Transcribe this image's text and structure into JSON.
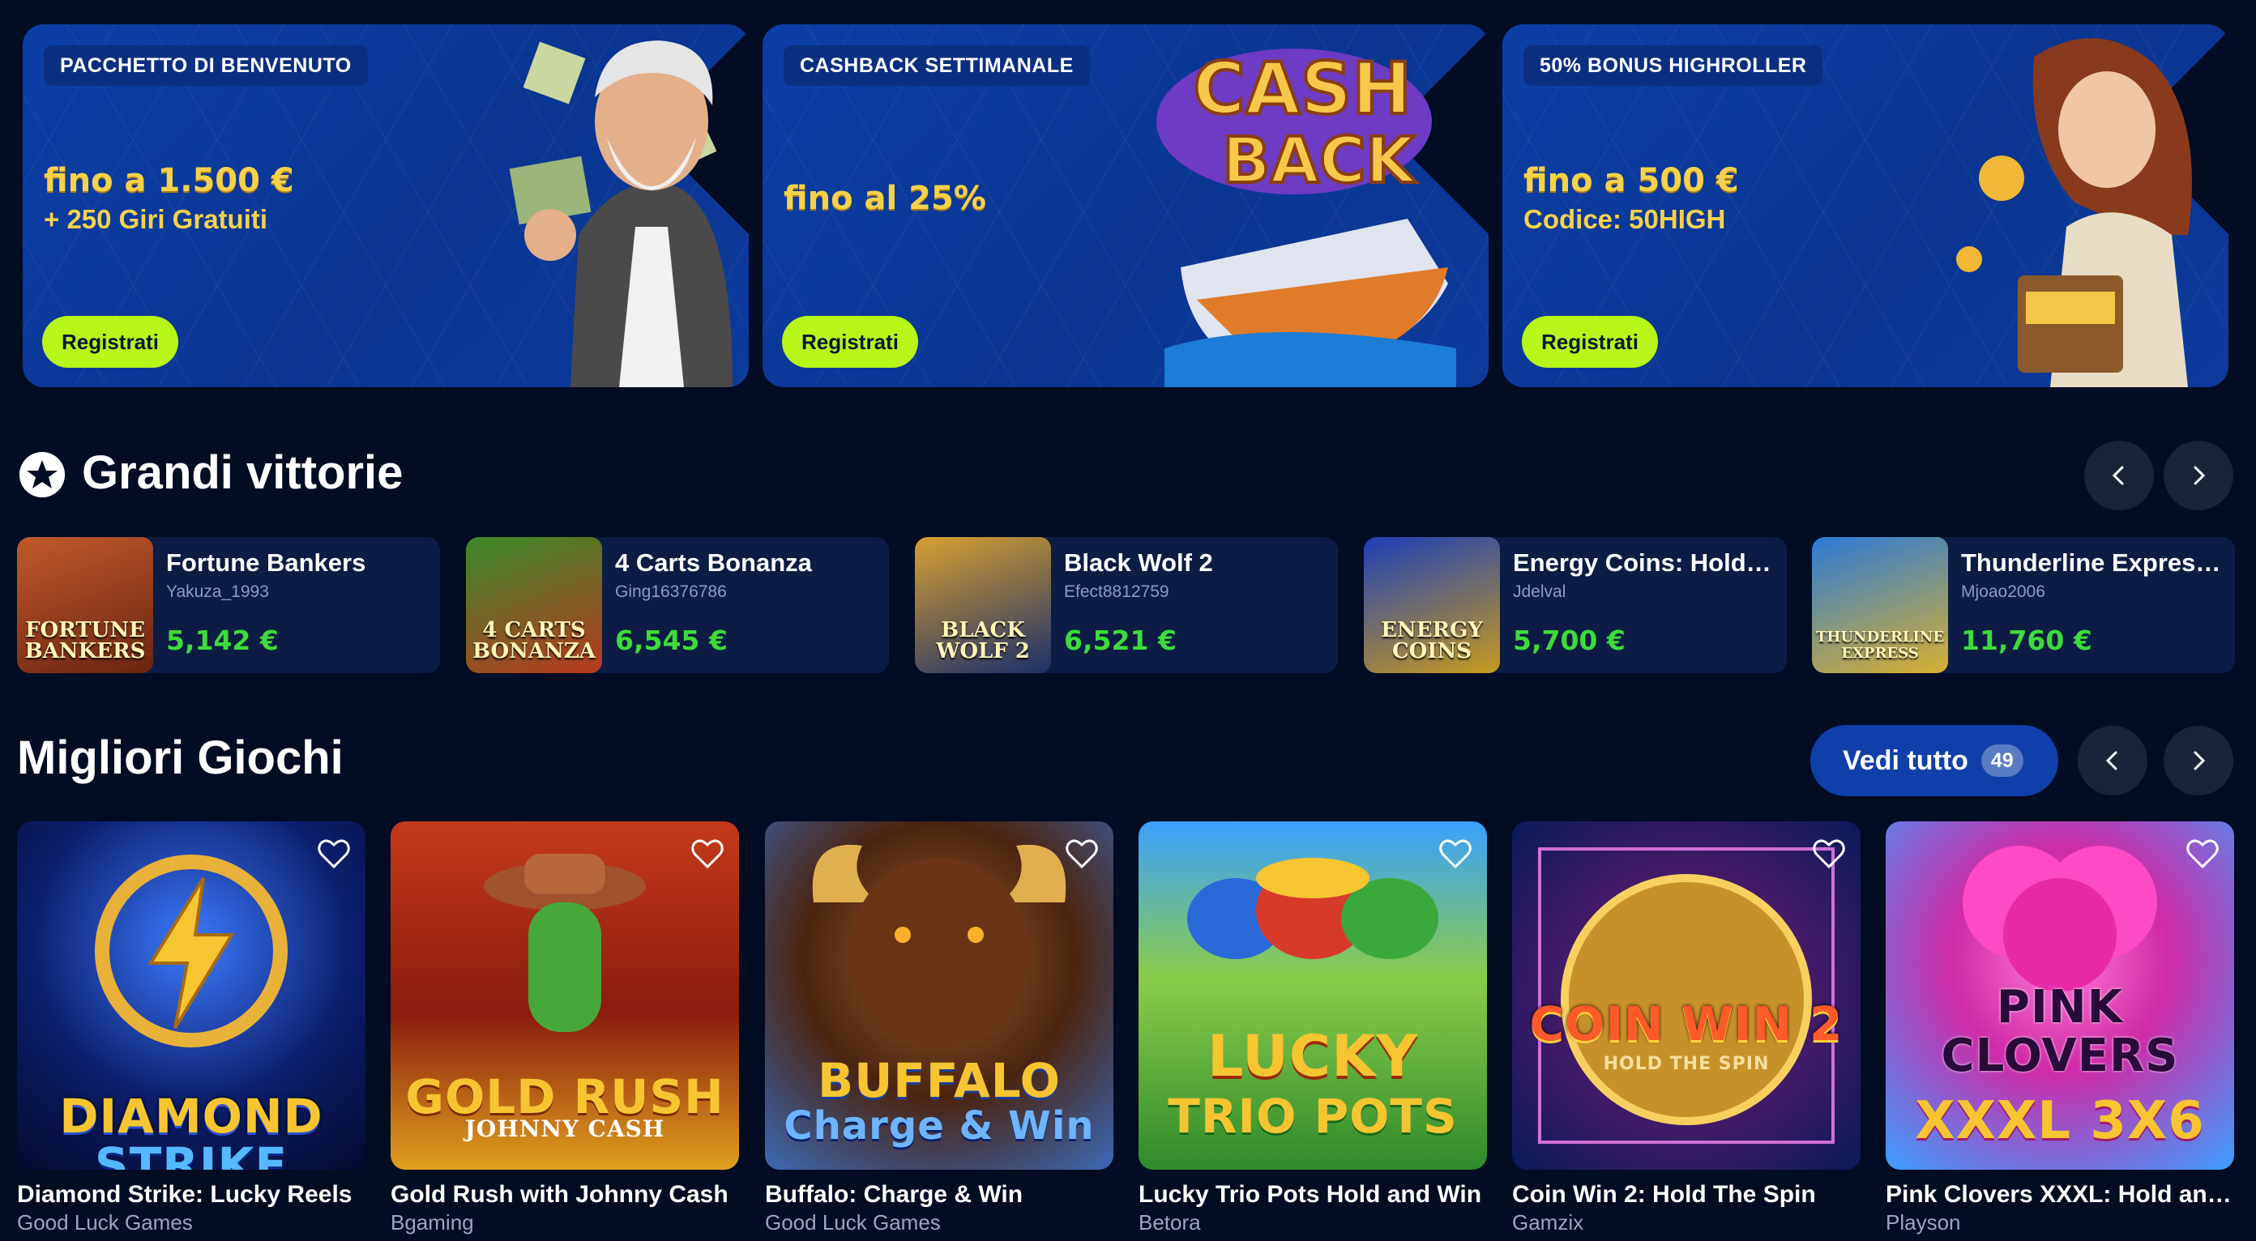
{
  "promos": [
    {
      "badge": "PACCHETTO DI BENVENUTO",
      "amount": "fino a 1.500 €",
      "subtitle": "+ 250 Giri Gratuiti",
      "button": "Registrati"
    },
    {
      "badge": "CASHBACK SETTIMANALE",
      "amount": "fino al 25%",
      "subtitle": "",
      "button": "Registrati",
      "art_text_1": "CASH",
      "art_text_2": "BACK"
    },
    {
      "badge": "50% BONUS HIGHROLLER",
      "amount": "fino a 500 €",
      "subtitle": "Codice: 50HIGH",
      "button": "Registrati"
    }
  ],
  "big_wins": {
    "title": "Grandi vittorie",
    "icon": "star-icon",
    "items": [
      {
        "game": "Fortune Bankers",
        "user": "Yakuza_1993",
        "amount": "5,142 €",
        "thumb_label": "FORTUNE BANKERS"
      },
      {
        "game": "4 Carts Bonanza",
        "user": "Ging16376786",
        "amount": "6,545 €",
        "thumb_label": "4 CARTS BONANZA"
      },
      {
        "game": "Black Wolf 2",
        "user": "Efect8812759",
        "amount": "6,521 €",
        "thumb_label": "BLACK WOLF 2"
      },
      {
        "game": "Energy Coins: Hold a...",
        "user": "Jdelval",
        "amount": "5,700 €",
        "thumb_label": "ENERGY COINS"
      },
      {
        "game": "Thunderline Express...",
        "user": "Mjoao2006",
        "amount": "11,760 €",
        "thumb_label": "THUNDERLINE EXPRESS"
      }
    ]
  },
  "top_games": {
    "title": "Migliori Giochi",
    "view_all_label": "Vedi tutto",
    "view_all_count": "49",
    "items": [
      {
        "title": "Diamond Strike: Lucky Reels",
        "provider": "Good Luck Games",
        "art_line_1": "DIAMOND",
        "art_line_2": "STRIKE"
      },
      {
        "title": "Gold Rush with Johnny Cash",
        "provider": "Bgaming",
        "art_line_1": "GOLD RUSH",
        "art_line_2": "JOHNNY CASH"
      },
      {
        "title": "Buffalo: Charge & Win",
        "provider": "Good Luck Games",
        "art_line_1": "BUFFALO",
        "art_line_2": "Charge & Win"
      },
      {
        "title": "Lucky Trio Pots Hold and Win",
        "provider": "Betora",
        "art_line_1": "LUCKY",
        "art_line_2": "TRIO POTS"
      },
      {
        "title": "Coin Win 2: Hold The Spin",
        "provider": "Gamzix",
        "art_line_1": "COIN WIN 2",
        "art_line_2": "HOLD THE SPIN"
      },
      {
        "title": "Pink Clovers XXXL: Hold and...",
        "provider": "Playson",
        "art_line_1": "PINK CLOVERS",
        "art_line_2": "XXXL 3X6"
      }
    ]
  },
  "colors": {
    "background": "#020c22",
    "card": "#0c1c44",
    "promo_blue": "#0b3fa6",
    "cta_green": "#b8f519",
    "win_green": "#3ddc3a",
    "gold_text": "#f6d24a"
  }
}
